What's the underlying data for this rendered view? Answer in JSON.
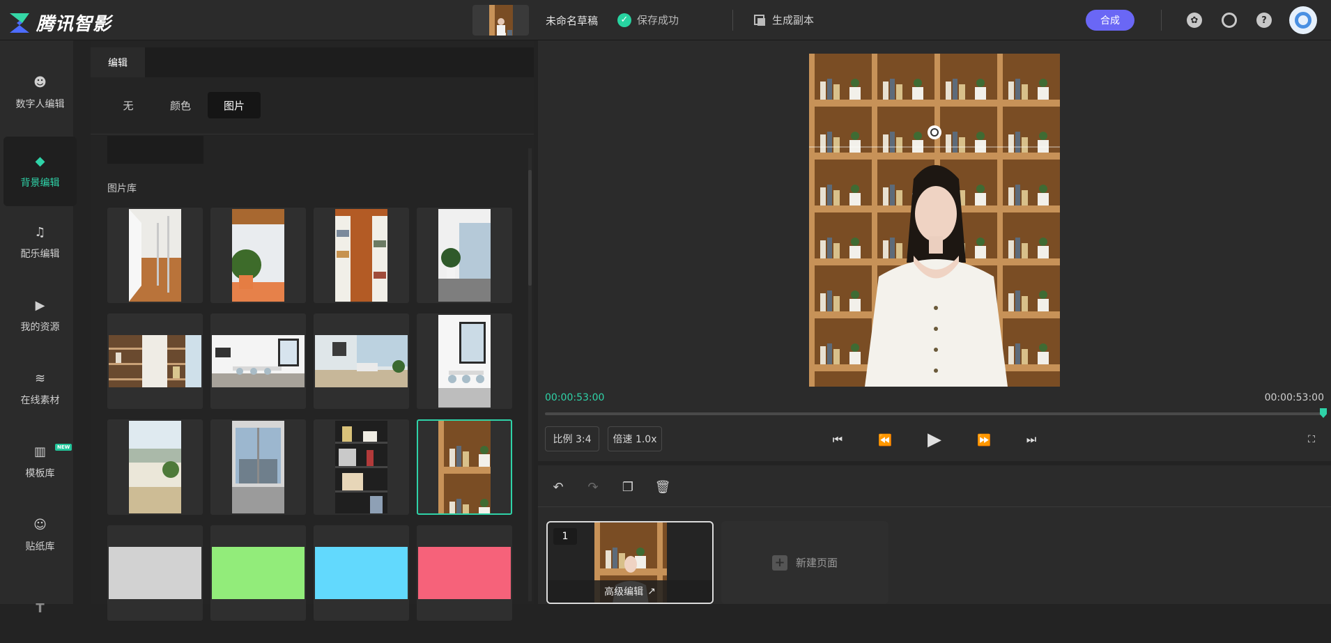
{
  "app": {
    "brand": "腾讯智影"
  },
  "header": {
    "draft_name": "未命名草稿",
    "save_status": "保存成功",
    "generate_copy": "生成副本",
    "compose_label": "合成",
    "icons": [
      "film-reel-icon",
      "headset-support-icon",
      "help-icon",
      "user-avatar-icon"
    ]
  },
  "sidebar": {
    "items": [
      {
        "label": "数字人编辑",
        "icon": "digital-human-icon",
        "active": false
      },
      {
        "label": "背景编辑",
        "icon": "paint-bucket-icon",
        "active": true
      },
      {
        "label": "配乐编辑",
        "icon": "music-note-icon",
        "active": false
      },
      {
        "label": "我的资源",
        "icon": "folder-play-icon",
        "active": false
      },
      {
        "label": "在线素材",
        "icon": "layers-icon",
        "active": false
      },
      {
        "label": "模板库",
        "icon": "template-icon",
        "active": false,
        "badge": "NEW"
      },
      {
        "label": "贴纸库",
        "icon": "sticker-face-icon",
        "active": false
      },
      {
        "label": "",
        "icon": "text-icon",
        "active": false
      }
    ]
  },
  "panel": {
    "tab": "编辑",
    "segments": [
      {
        "label": "无",
        "active": false
      },
      {
        "label": "颜色",
        "active": false
      },
      {
        "label": "图片",
        "active": true
      }
    ],
    "library_label": "图片库",
    "selected_index": 11,
    "swatch_colors": [
      "#d2d2d2",
      "#92ec7a",
      "#62d9fd",
      "#f6627a"
    ]
  },
  "preview": {
    "time_current": "00:00:53:00",
    "time_total": "00:00:53:00",
    "progress": 1.0,
    "ratio_label": "比例 3:4",
    "speed_label": "倍速 1.0x"
  },
  "timeline": {
    "page_number": "1",
    "advanced_edit": "高级编辑",
    "new_page": "新建页面"
  },
  "colors": {
    "accent": "#2fd3a8",
    "compose": "#6a67f5"
  }
}
